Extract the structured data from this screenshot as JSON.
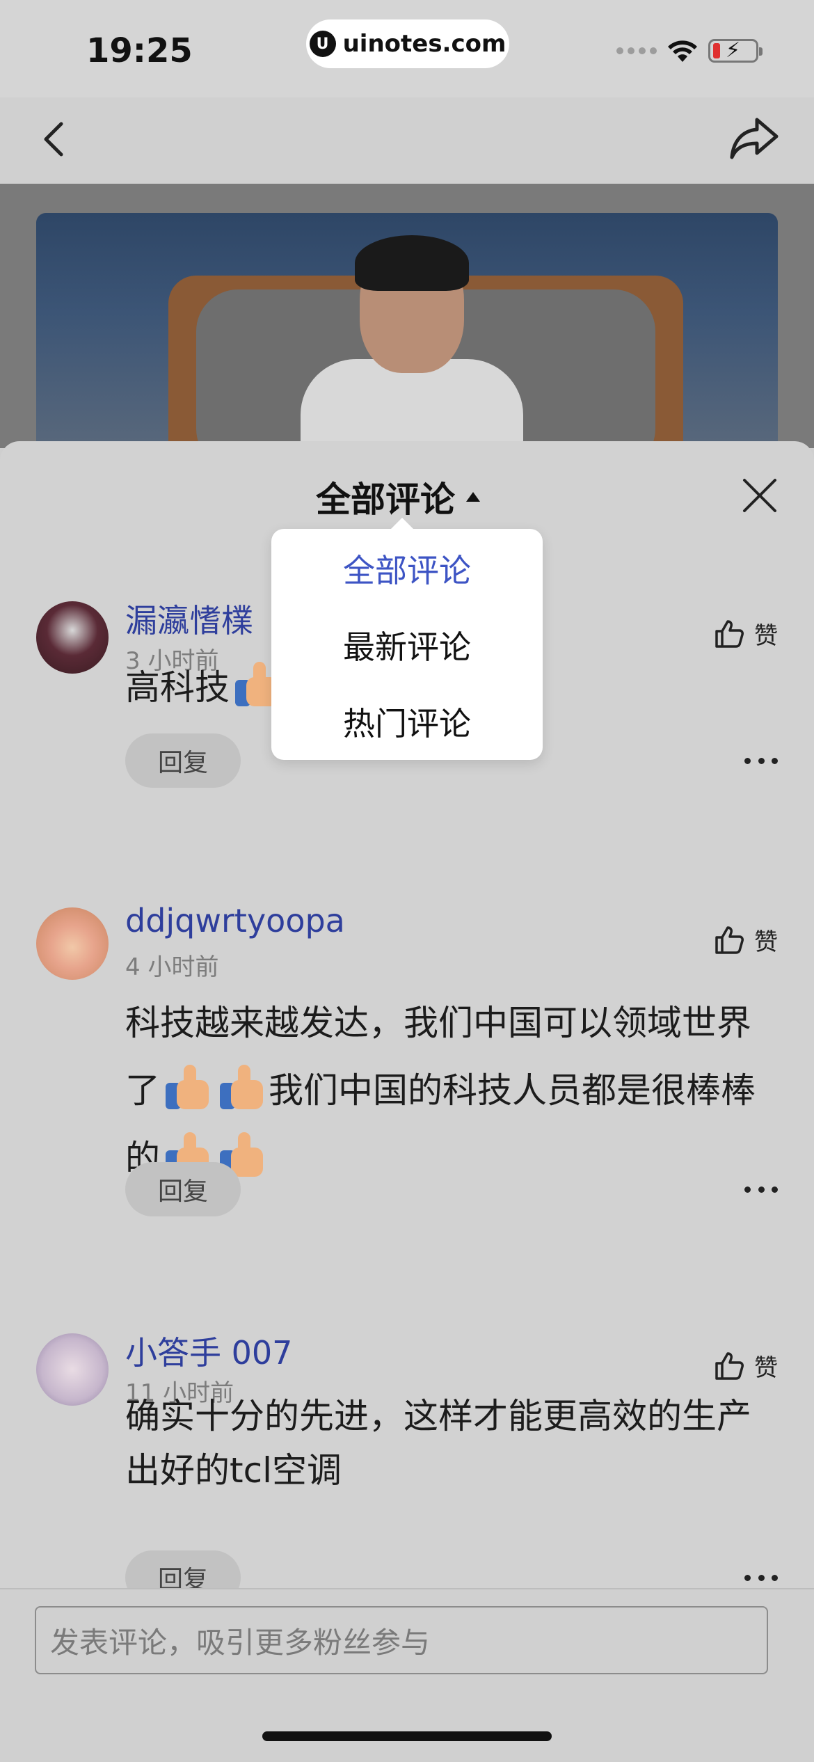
{
  "status_bar": {
    "time": "19:25",
    "url": "uinotes.com",
    "url_logo": "U"
  },
  "sheet": {
    "title": "全部评论"
  },
  "sort_menu": {
    "options": [
      "全部评论",
      "最新评论",
      "热门评论"
    ],
    "selected": "全部评论"
  },
  "comments": [
    {
      "username": "漏瀛愭檏",
      "time": "3 小时前",
      "text": "高科技",
      "like_label": "赞",
      "reply_label": "回复"
    },
    {
      "username": "ddjqwrtyoopa",
      "time": "4 小时前",
      "text_1": "科技越来越发达，我们中国可以领域世界了",
      "text_2": "我们中国的科技人员都是很棒棒的",
      "like_label": "赞",
      "reply_label": "回复"
    },
    {
      "username": "小答手 007",
      "time": "11 小时前",
      "text": "确实十分的先进，这样才能更高效的生产出好的tcl空调",
      "like_label": "赞",
      "reply_label": "回复"
    }
  ],
  "input": {
    "placeholder": "发表评论，吸引更多粉丝参与"
  },
  "colors": {
    "accent": "#3d54c4",
    "username": "#2e3e9c",
    "overlay_bg": "#d2d2d2"
  }
}
